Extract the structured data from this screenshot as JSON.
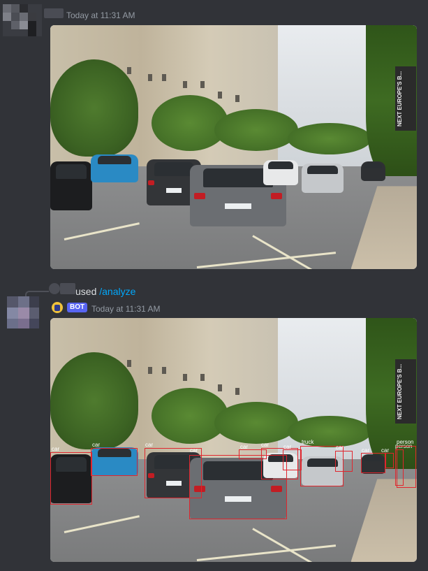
{
  "message1": {
    "timestamp": "Today at 11:31 AM",
    "image_description_label": "Street traffic photo"
  },
  "message2": {
    "used_prefix": "used",
    "command": "/analyze",
    "bot_badge": "BOT",
    "timestamp": "Today at 11:31 AM"
  },
  "scene": {
    "banner_text": "NEXT EUROPE'S B..."
  },
  "detections": [
    {
      "label": "car"
    },
    {
      "label": "car"
    },
    {
      "label": "car"
    },
    {
      "label": "car"
    },
    {
      "label": "car"
    },
    {
      "label": "car"
    },
    {
      "label": "car"
    },
    {
      "label": "truck"
    },
    {
      "label": "car"
    },
    {
      "label": "car"
    },
    {
      "label": "car"
    },
    {
      "label": "person"
    },
    {
      "label": "person"
    }
  ],
  "colors": {
    "background": "#313338",
    "timestamp": "#949ba4",
    "command": "#00a8fc",
    "bot_badge": "#5865f2",
    "bbox": "#e0262e"
  }
}
